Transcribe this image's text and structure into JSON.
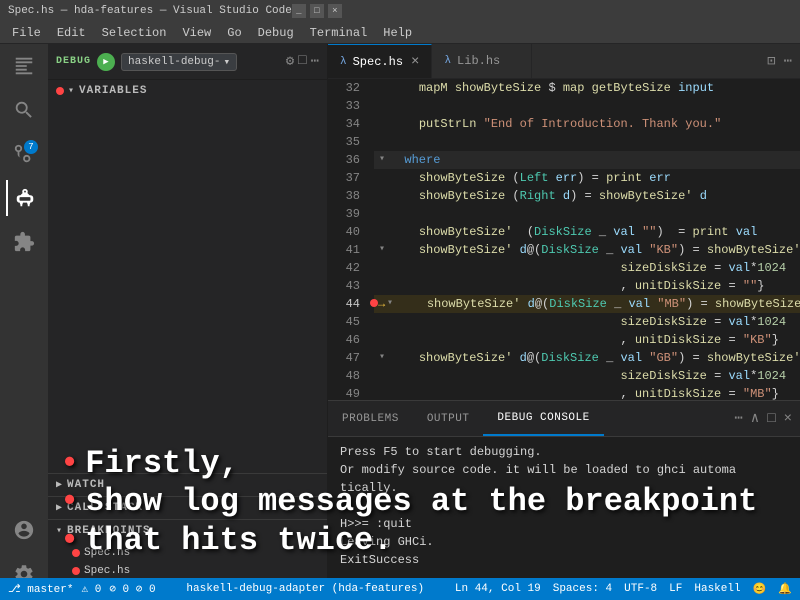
{
  "titlebar": {
    "title": "Spec.hs — hda-features — Visual Studio Code",
    "controls": [
      "_",
      "□",
      "×"
    ]
  },
  "menubar": {
    "items": [
      "File",
      "Edit",
      "Selection",
      "View",
      "Go",
      "Debug",
      "Terminal",
      "Help"
    ]
  },
  "activitybar": {
    "icons": [
      {
        "name": "explorer-icon",
        "symbol": "⎘",
        "active": false
      },
      {
        "name": "search-icon",
        "symbol": "🔍",
        "active": false
      },
      {
        "name": "source-control-icon",
        "symbol": "⑂",
        "active": false,
        "badge": "7"
      },
      {
        "name": "debug-icon",
        "symbol": "🐛",
        "active": true
      },
      {
        "name": "extensions-icon",
        "symbol": "⊞",
        "active": false
      }
    ],
    "bottom_icons": [
      {
        "name": "settings-icon",
        "symbol": "⚙"
      },
      {
        "name": "account-icon",
        "symbol": "👤"
      }
    ]
  },
  "debug_toolbar": {
    "label": "DEBUG",
    "session": "haskell-debug-▾",
    "icons": [
      "⚙",
      "□",
      "⋯"
    ]
  },
  "sidebar": {
    "sections": [
      {
        "name": "VARIABLES",
        "expanded": true
      },
      {
        "name": "WATCH",
        "expanded": false
      },
      {
        "name": "CALL STACK",
        "expanded": false
      },
      {
        "name": "BREAKPOINTS",
        "expanded": true
      }
    ],
    "breakpoints": [
      {
        "file": "Spec.hs",
        "active": true
      },
      {
        "file": "Spec.hs",
        "active": true
      },
      {
        "file": "Spec.hs",
        "active": true
      }
    ]
  },
  "tabs": [
    {
      "label": "Spec.hs",
      "active": true,
      "icon": "hs"
    },
    {
      "label": "Lib.hs",
      "active": false,
      "icon": "hs"
    }
  ],
  "lines": [
    {
      "num": 32,
      "content": "    mapM showByteSize $ map getByteSize input",
      "fold": false,
      "breakpoint": false
    },
    {
      "num": 33,
      "content": "",
      "fold": false,
      "breakpoint": false
    },
    {
      "num": 34,
      "content": "    putStrLn \"End of Introduction. Thank you.\"",
      "fold": false,
      "breakpoint": false
    },
    {
      "num": 35,
      "content": "",
      "fold": false,
      "breakpoint": false
    },
    {
      "num": 36,
      "content": "  where",
      "fold": true,
      "breakpoint": false,
      "highlight": true
    },
    {
      "num": 37,
      "content": "    showByteSize (Left err) = print err",
      "fold": false,
      "breakpoint": false
    },
    {
      "num": 38,
      "content": "    showByteSize (Right d) = showByteSize' d",
      "fold": false,
      "breakpoint": false
    },
    {
      "num": 39,
      "content": "",
      "fold": false,
      "breakpoint": false
    },
    {
      "num": 40,
      "content": "    showByteSize'  (DiskSize _ val \"\")  = print val",
      "fold": false,
      "breakpoint": false
    },
    {
      "num": 41,
      "content": "    showByteSize' d@(DiskSize _ val \"KB\") = showByteSize' d {",
      "fold": true,
      "breakpoint": false
    },
    {
      "num": 42,
      "content": "                                                sizeDiskSize = val*1024",
      "fold": false,
      "breakpoint": false
    },
    {
      "num": 43,
      "content": "                                              , unitDiskSize = \"\"}",
      "fold": false,
      "breakpoint": false
    },
    {
      "num": 44,
      "content": "    showByteSize' d@(DiskSize _ val \"MB\") = showByteSize' d {",
      "fold": true,
      "breakpoint": true,
      "arrow": true
    },
    {
      "num": 45,
      "content": "                                                sizeDiskSize = val*1024",
      "fold": false,
      "breakpoint": false
    },
    {
      "num": 46,
      "content": "                                              , unitDiskSize = \"KB\"}",
      "fold": false,
      "breakpoint": false
    },
    {
      "num": 47,
      "content": "    showByteSize' d@(DiskSize _ val \"GB\") = showByteSize' d {",
      "fold": true,
      "breakpoint": false
    },
    {
      "num": 48,
      "content": "                                                sizeDiskSize = val*1024",
      "fold": false,
      "breakpoint": false
    },
    {
      "num": 49,
      "content": "                                              , unitDiskSize = \"MB\"}",
      "fold": false,
      "breakpoint": false
    }
  ],
  "panel": {
    "tabs": [
      "PROBLEMS",
      "OUTPUT",
      "DEBUG CONSOLE"
    ],
    "active_tab": "DEBUG CONSOLE",
    "content": [
      "Press F5 to start debugging.",
      "Or modify source code. it will be loaded to ghci automa",
      "tically.",
      "",
      "H>>= :quit",
      "Leaving GHCi.",
      "ExitSuccess"
    ]
  },
  "statusbar": {
    "left": [
      "⎇ master*",
      "⚠ 0",
      "⚐ 0 ⊘ 0"
    ],
    "center": "haskell-debug-adapter (hda-features)",
    "right": [
      "Ln 44, Col 19",
      "Spaces: 4",
      "UTF-8",
      "LF",
      "Haskell",
      "😊",
      "🔔"
    ]
  },
  "overlay": {
    "lines": [
      "Firstly,",
      "show log messages at the breakpoint",
      "that hits twice."
    ]
  },
  "colors": {
    "accent": "#007acc",
    "active_tab_border": "#007acc",
    "background": "#1e1e1e",
    "sidebar_bg": "#252526",
    "activitybar_bg": "#333333",
    "breakpoint_color": "#f44444",
    "debug_green": "#4caf50"
  }
}
